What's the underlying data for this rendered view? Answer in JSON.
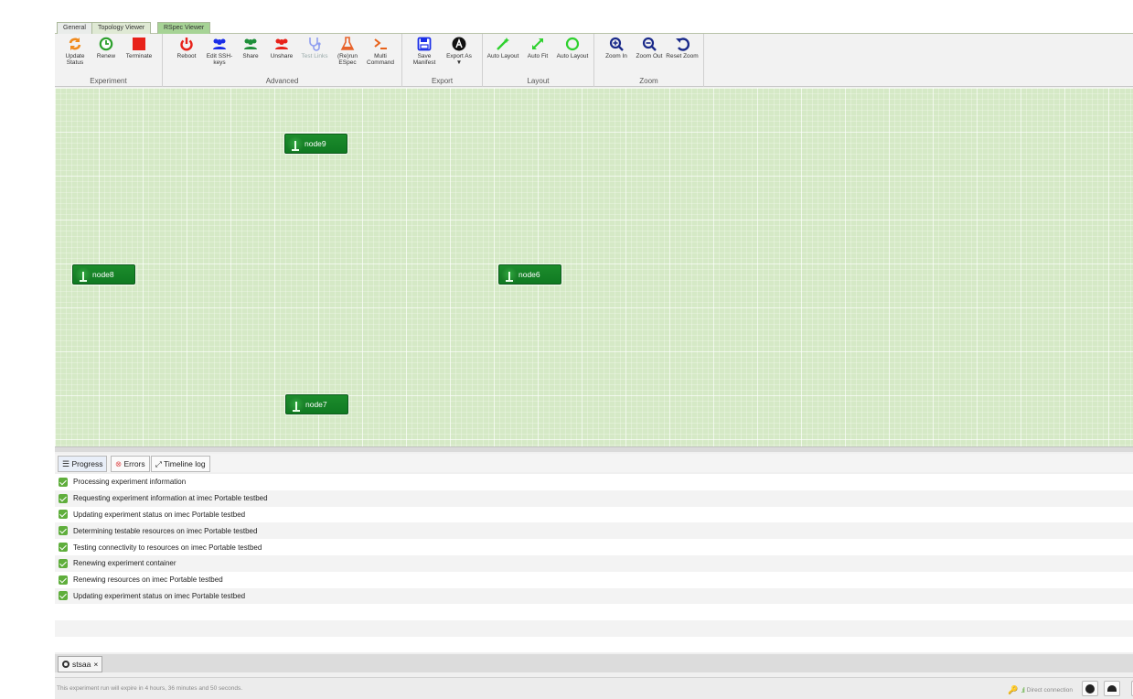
{
  "tabs": [
    {
      "label": "General"
    },
    {
      "label": "Topology Viewer"
    },
    {
      "label": "RSpec Viewer"
    }
  ],
  "toolbar": {
    "groups": {
      "experiment": "Experiment",
      "advanced": "Advanced",
      "export": "Export",
      "layout": "Layout",
      "zoom": "Zoom"
    },
    "buttons": {
      "update_status": "Update Status",
      "renew": "Renew",
      "terminate": "Terminate",
      "reboot": "Reboot",
      "edit_ssh_keys": "Edit SSH-keys",
      "share": "Share",
      "unshare": "Unshare",
      "test_links": "Test Links",
      "rerun_espec": "(Re)run ESpec",
      "multi_command": "Multi Command",
      "save_manifest": "Save Manifest",
      "export_as": "Export As",
      "auto_layout_1": "Auto Layout",
      "auto_fit": "Auto Fit",
      "auto_layout_2": "Auto Layout",
      "zoom_in": "Zoom In",
      "zoom_out": "Zoom Out",
      "reset_zoom": "Reset Zoom"
    },
    "colors": {
      "update": "#f08a1c",
      "renew": "#2ca02c",
      "terminate": "#e8221a",
      "reboot": "#e8221a",
      "keys": "#1a2ee8",
      "share": "#1f8f3a",
      "unshare": "#e8221a",
      "test": "#8f9ef0",
      "espec": "#e8622a",
      "multi": "#e8621a",
      "save": "#1a2ee8",
      "export": "#111111",
      "layout": "#2ed12e",
      "zoom": "#1a2a8a"
    }
  },
  "nodes": [
    {
      "name": "node9"
    },
    {
      "name": "node8"
    },
    {
      "name": "node6"
    },
    {
      "name": "node7"
    }
  ],
  "progress_tabs": {
    "progress": "Progress",
    "errors": "Errors",
    "timeline": "Timeline log"
  },
  "progress_items": [
    "Processing experiment information",
    "Requesting experiment information at imec Portable testbed",
    "Updating experiment status on imec Portable testbed",
    "Determining testable resources on imec Portable testbed",
    "Testing connectivity to resources on imec Portable testbed",
    "Renewing experiment container",
    "Renewing resources on imec Portable testbed",
    "Updating experiment status on imec Portable testbed"
  ],
  "experiment_tab": {
    "label": "stsaa",
    "close": "×"
  },
  "status": {
    "expiry": "This experiment run will expire in 4 hours, 36 minutes and 50 seconds.",
    "connection": "Direct connection"
  }
}
